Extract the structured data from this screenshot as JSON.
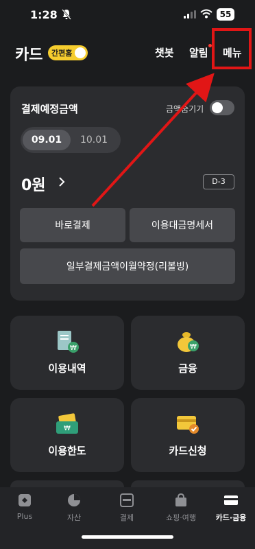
{
  "status_bar": {
    "time": "1:28",
    "battery": "55"
  },
  "header": {
    "title": "카드",
    "simple_mode_label": "간편홈",
    "chatbot": "챗봇",
    "alarm": "알림",
    "menu": "메뉴"
  },
  "payment": {
    "title": "결제예정금액",
    "hide_amount_label": "금액숨기기",
    "dates": [
      "09.01",
      "10.01"
    ],
    "selected_date": "09.01",
    "amount": "0원",
    "dday": "D-3",
    "pay_now": "바로결제",
    "statement": "이용대금명세서",
    "revolving": "일부결제금액이월약정(리볼빙)"
  },
  "tiles": [
    {
      "label": "이용내역",
      "icon": "receipt-won-icon"
    },
    {
      "label": "금융",
      "icon": "money-bag-icon"
    },
    {
      "label": "이용한도",
      "icon": "wallet-card-icon"
    },
    {
      "label": "카드신청",
      "icon": "card-check-icon"
    }
  ],
  "bottom_nav": [
    {
      "label": "Plus",
      "icon": "plus-tab-icon"
    },
    {
      "label": "자산",
      "icon": "pie-chart-icon"
    },
    {
      "label": "결제",
      "icon": "scan-pay-icon"
    },
    {
      "label": "쇼핑·여행",
      "icon": "shopping-bag-icon"
    },
    {
      "label": "카드·금융",
      "icon": "card-icon"
    }
  ],
  "colors": {
    "background": "#1b1c1e",
    "card": "#2b2c2f",
    "accent_yellow": "#f6cd2e",
    "highlight_red": "#e11616"
  }
}
